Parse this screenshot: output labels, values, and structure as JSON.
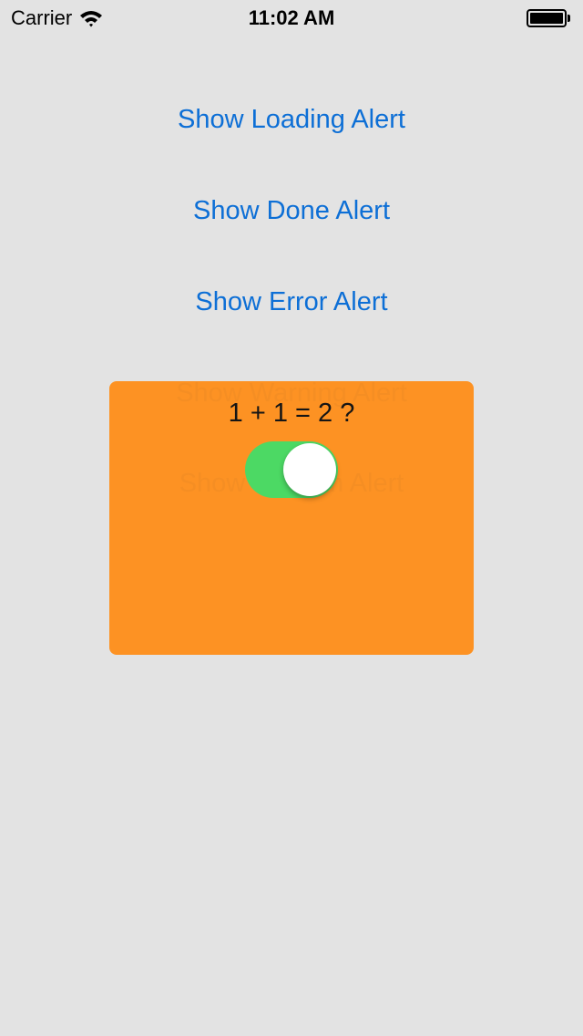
{
  "status_bar": {
    "carrier": "Carrier",
    "time": "11:02 AM",
    "wifi_icon": "wifi-icon",
    "battery_icon": "battery-icon",
    "battery_level": 1.0
  },
  "buttons": {
    "loading": "Show Loading Alert",
    "done": "Show Done Alert",
    "error": "Show Error Alert",
    "warning": "Show Warning Alert",
    "custom": "Show Custom Alert"
  },
  "custom_alert": {
    "question": "1 + 1 = 2 ?",
    "toggle_on": true,
    "background_color": "#ff8c14"
  },
  "colors": {
    "background": "#e3e3e3",
    "link": "#0d6fd6",
    "toggle_on": "#4cd964"
  }
}
